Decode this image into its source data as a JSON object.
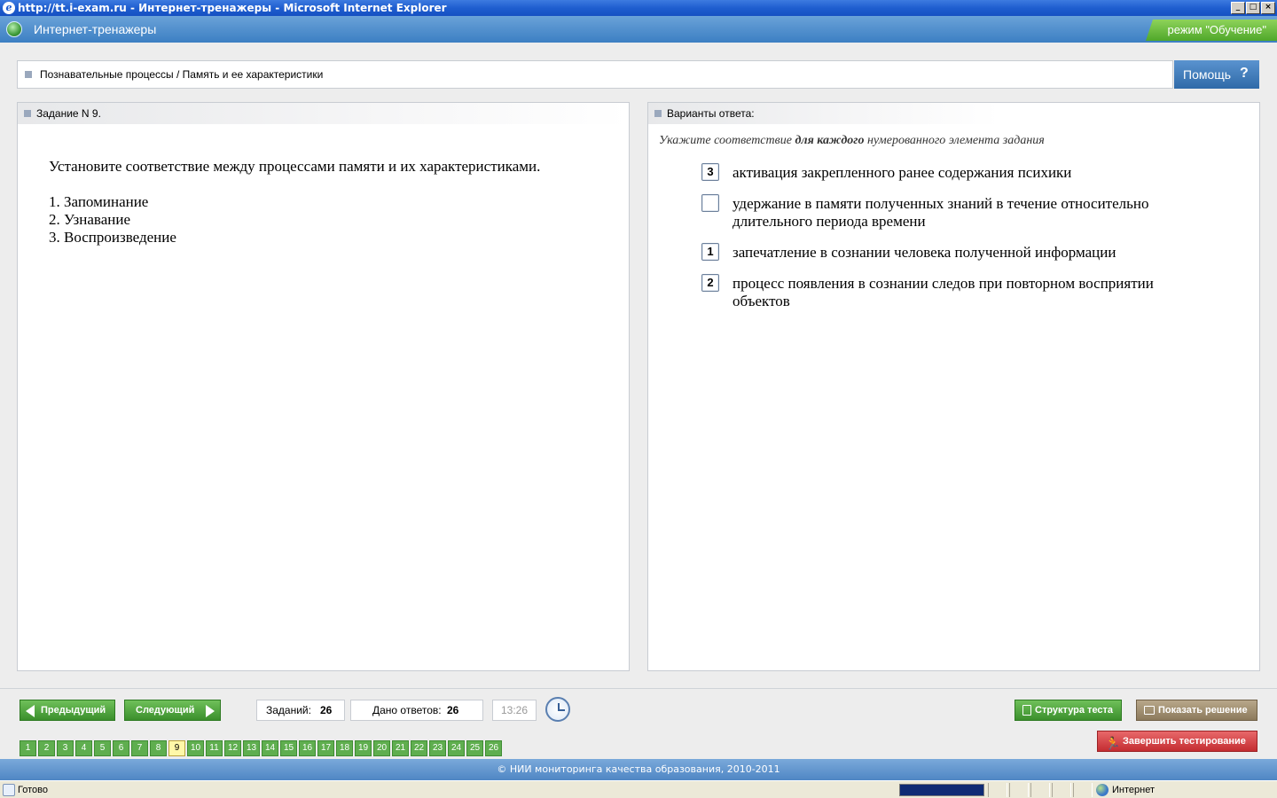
{
  "window": {
    "title": "http://tt.i-exam.ru - Интернет-тренажеры - Microsoft Internet Explorer",
    "controls": [
      "_",
      "□",
      "×"
    ]
  },
  "app": {
    "title": "Интернет-тренажеры",
    "mode": "режим \"Обучение\""
  },
  "breadcrumb": "Познавательные процессы / Память и ее характеристики",
  "help_label": "Помощь",
  "help_icon": "?",
  "task": {
    "header": "Задание N 9.",
    "question": "Установите соответствие между процессами памяти и их характеристиками.",
    "items": [
      "1. Запоминание",
      "2. Узнавание",
      "3. Воспроизведение"
    ]
  },
  "answers": {
    "header": "Варианты ответа:",
    "instruction_pre": "Укажите соответствие ",
    "instruction_bold": "для каждого",
    "instruction_post": " нумерованного элемента задания",
    "options": [
      {
        "value": "3",
        "text": "активация закрепленного ранее содержания психики"
      },
      {
        "value": "",
        "text": "удержание в памяти полученных знаний в течение относительно длительного периода времени"
      },
      {
        "value": "1",
        "text": "запечатление в сознании человека полученной информации"
      },
      {
        "value": "2",
        "text": "процесс появления в сознании следов при повторном восприятии объектов"
      }
    ]
  },
  "toolbar": {
    "prev_label": "Предыдущий",
    "next_label": "Следующий",
    "tasks_label": "Заданий: ",
    "tasks_count": "26",
    "answers_label": "Дано ответов:",
    "answers_count": "26",
    "timer": "13:26",
    "structure_label": "Структура теста",
    "show_solution_label": "Показать решение",
    "finish_label": "Завершить тестирование"
  },
  "pages": [
    "1",
    "2",
    "3",
    "4",
    "5",
    "6",
    "7",
    "8",
    "9",
    "10",
    "11",
    "12",
    "13",
    "14",
    "15",
    "16",
    "17",
    "18",
    "19",
    "20",
    "21",
    "22",
    "23",
    "24",
    "25",
    "26"
  ],
  "active_page": "9",
  "footer": "© НИИ мониторинга качества образования, 2010-2011",
  "status": {
    "text": "Готово",
    "zone": "Интернет"
  }
}
